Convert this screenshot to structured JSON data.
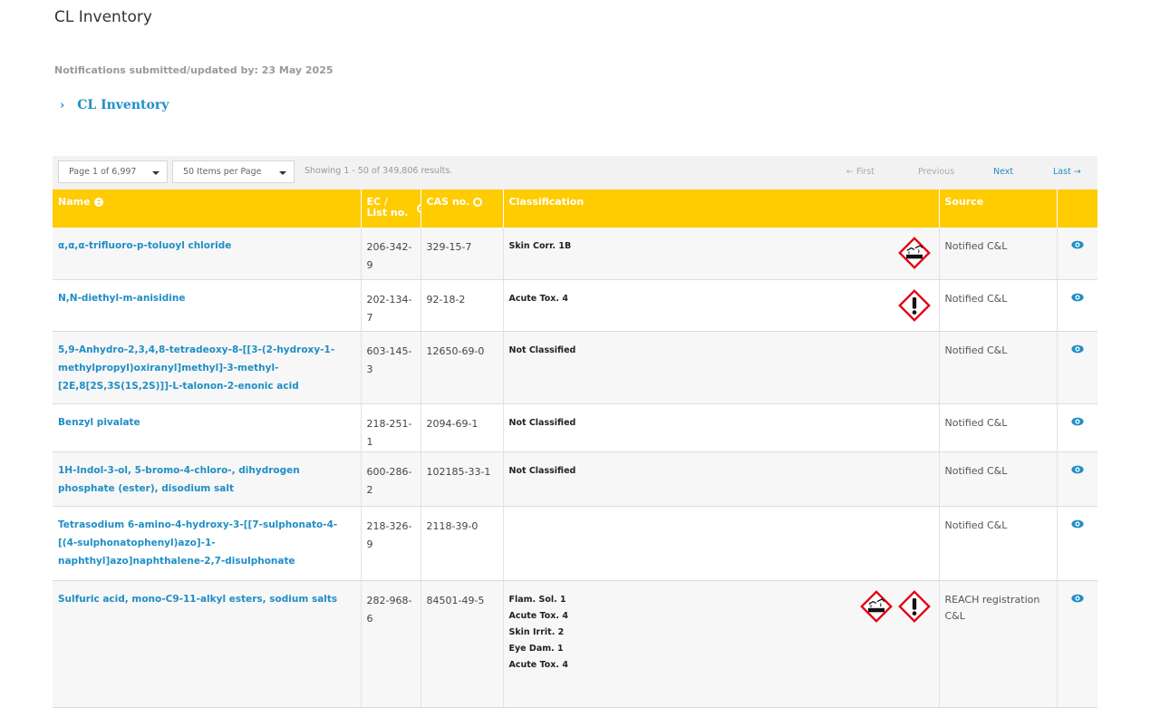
{
  "title": "CL Inventory",
  "notification_text": "Notifications submitted/updated by: 23 May 2025",
  "breadcrumb": {
    "chevron": "›",
    "label": "CL Inventory"
  },
  "toolbar": {
    "page_select": "Page 1 of 6,997",
    "items_select": "50 Items per Page",
    "showing": "Showing 1 - 50 of 349,806 results.",
    "first": "← First",
    "previous": "Previous",
    "next": "Next",
    "last": "Last →"
  },
  "columns": {
    "name": "Name",
    "ec_line1": "EC /",
    "ec_line2": "List no.",
    "cas": "CAS no.",
    "classification": "Classification",
    "source": "Source"
  },
  "rows": [
    {
      "name": "α,α,α-trifluoro-p-toluoyl chloride",
      "ec": "206-342-9",
      "cas": "329-15-7",
      "classifications": [
        "Skin Corr. 1B"
      ],
      "pictograms": [
        "corrosion-pictogram"
      ],
      "source": "Notified C&L"
    },
    {
      "name": "N,N-diethyl-m-anisidine",
      "ec": "202-134-7",
      "cas": "92-18-2",
      "classifications": [
        "Acute Tox. 4"
      ],
      "pictograms": [
        "exclamation-pictogram"
      ],
      "source": "Notified C&L"
    },
    {
      "name": "5,9-Anhydro-2,3,4,8-tetradeoxy-8-[[3-(2-hydroxy-1-methylpropyl)oxiranyl]methyl]-3-methyl-[2E,8[2S,3S(1S,2S)]]-L-talonon-2-enonic acid",
      "ec": "603-145-3",
      "cas": "12650-69-0",
      "classifications": [
        "Not Classified"
      ],
      "pictograms": [],
      "source": "Notified C&L"
    },
    {
      "name": "Benzyl pivalate",
      "ec": "218-251-1",
      "cas": "2094-69-1",
      "classifications": [
        "Not Classified"
      ],
      "pictograms": [],
      "source": "Notified C&L"
    },
    {
      "name": "1H-Indol-3-ol, 5-bromo-4-chloro-, dihydrogen phosphate (ester), disodium salt",
      "ec": "600-286-2",
      "cas": "102185-33-1",
      "classifications": [
        "Not Classified"
      ],
      "pictograms": [],
      "source": "Notified C&L"
    },
    {
      "name": "Tetrasodium 6-amino-4-hydroxy-3-[[7-sulphonato-4-[(4-sulphonatophenyl)azo]-1-naphthyl]azo]naphthalene-2,7-disulphonate",
      "ec": "218-326-9",
      "cas": "2118-39-0",
      "classifications": [],
      "pictograms": [],
      "source": "Notified C&L"
    },
    {
      "name": "Sulfuric acid, mono-C9-11-alkyl esters, sodium salts",
      "ec": "282-968-6",
      "cas": "84501-49-5",
      "classifications": [
        "Flam. Sol. 1",
        "Acute Tox. 4",
        "Skin Irrit. 2",
        "Eye Dam. 1",
        "Acute Tox. 4"
      ],
      "pictograms": [
        "corrosion-pictogram",
        "exclamation-pictogram"
      ],
      "source": "REACH registration C&L"
    }
  ],
  "colors": {
    "header_bg": "#fecc00",
    "link": "#1f8ec6",
    "hazard_red": "#e3000f"
  },
  "icons": {
    "view": "eye-icon",
    "sort": "sort-icon"
  }
}
